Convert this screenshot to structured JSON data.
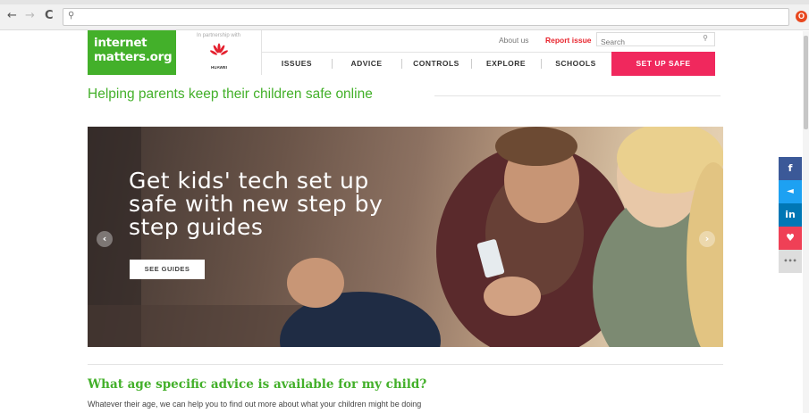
{
  "browser": {
    "back_icon": "←",
    "forward_icon": "→",
    "reload_icon": "C",
    "address_value": "",
    "search_glyph": "🔍",
    "extension_icon": "O"
  },
  "header": {
    "logo_line1": "internet",
    "logo_line2": "matters.org",
    "partner_text": "In partnership with",
    "partner_name": "HUAWEI",
    "about_us": "About us",
    "report_issue": "Report issue",
    "search_placeholder": "Search",
    "search_icon": "search-icon",
    "nav": [
      "ISSUES",
      "ADVICE",
      "CONTROLS",
      "EXPLORE",
      "SCHOOLS",
      "SET UP SAFE"
    ]
  },
  "main": {
    "tagline": "Helping parents keep their children safe online",
    "hero": {
      "caption_line1": "Get kids' tech set up",
      "caption_line2": "safe with new step by",
      "caption_line3": "step guides",
      "button": "SEE GUIDES",
      "prev_arrow": "‹",
      "next_arrow": "›"
    },
    "section_heading": "What age specific advice is available for my child?",
    "section_text": "Whatever their age, we can help you to find out more about what your children might be doing"
  },
  "social": [
    {
      "name": "facebook",
      "glyph": "f",
      "color": "#3b5998"
    },
    {
      "name": "twitter",
      "glyph": "🐦",
      "color": "#1da1f2"
    },
    {
      "name": "linkedin",
      "glyph": "in",
      "color": "#0077b5"
    },
    {
      "name": "pocket",
      "glyph": "♥",
      "color": "#ef4056"
    },
    {
      "name": "more",
      "glyph": "•••",
      "color": "#dddddd"
    }
  ],
  "colors": {
    "brand_green": "#43b02a",
    "cta_pink": "#f0285d",
    "report_red": "#e8242d"
  }
}
